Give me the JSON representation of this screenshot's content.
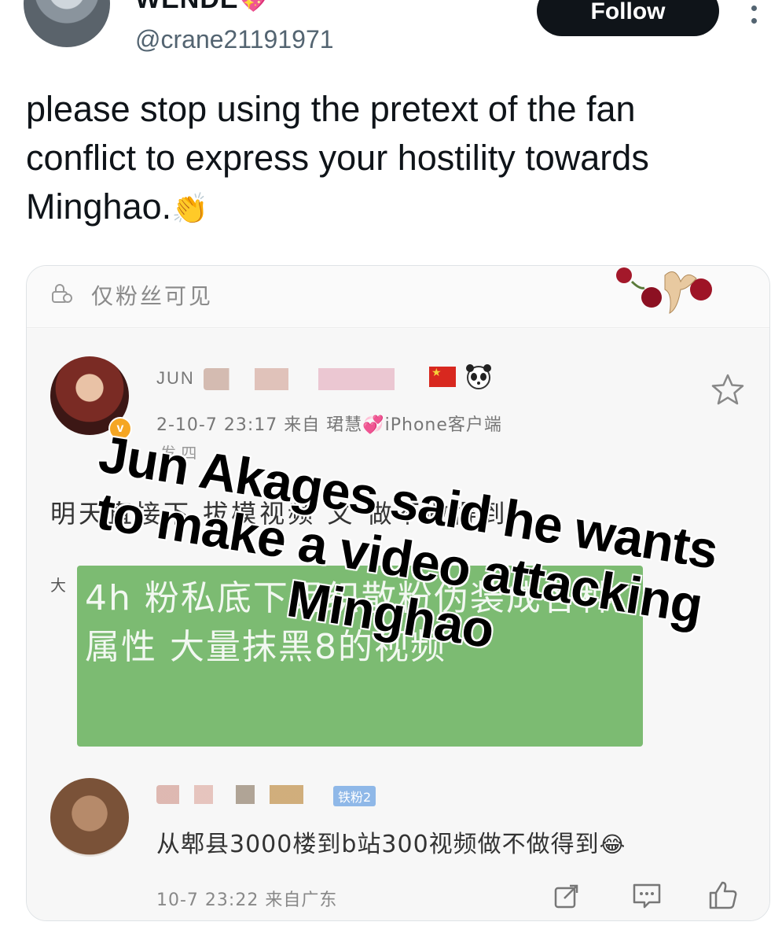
{
  "tweet": {
    "display_name": "WENDE",
    "display_name_emoji": "💖",
    "handle": "@crane21191971",
    "follow_label": "Follow",
    "text": "please stop using the pretext of the fan conflict to express your hostility towards Minghao.",
    "text_emoji": "👏"
  },
  "embedded_screenshot": {
    "visibility_label": "仅粉丝可见",
    "poster_name": "JUN",
    "post_meta": "2-10-7 23:17  来自 珺慧💞iPhone客户端",
    "post_meta_2": "发 四",
    "post_body": "明天直接下 拔模视频 文 做不做得到",
    "small_prefix": "大",
    "green_text": "4h 粉私底下组织散粉伪装成各种属性 大量抹黑8的视频",
    "reply_fan_badge": "铁粉2",
    "reply_text": "从郫县3000楼到b站300视频做不做得到",
    "reply_emoji": "😂",
    "reply_meta": "10-7 23:22 来自广东"
  },
  "overlay_caption": "Jun Akages said he wants to make a video attacking Minghao",
  "icons": [
    "more-icon",
    "lock-icon",
    "roses-decoration",
    "verified-badge",
    "flag-icon",
    "panda-icon",
    "star-icon",
    "share-icon",
    "comment-icon",
    "like-icon",
    "clap-icon",
    "laugh-icon"
  ]
}
